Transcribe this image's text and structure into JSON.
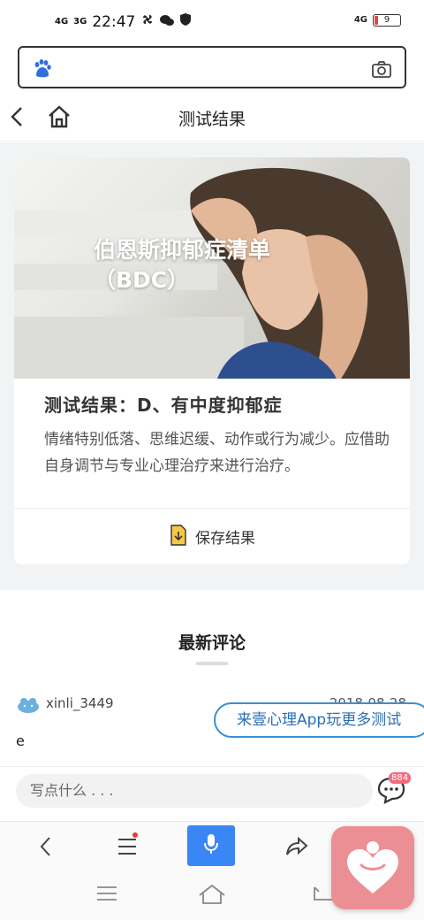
{
  "status_bar": {
    "network_1": "4G",
    "network_2": "3G",
    "time": "22:47",
    "network_right": "4G",
    "battery": "9"
  },
  "search": {
    "value": "",
    "logo_icon": "baidu-paw-icon",
    "camera_icon": "camera-icon"
  },
  "nav": {
    "title": "测试结果",
    "back_icon": "back-arrow-icon",
    "home_icon": "home-icon"
  },
  "card": {
    "hero_title_line1": "伯恩斯抑郁症清单",
    "hero_title_line2": "（BDC）",
    "result_title": "测试结果：D、有中度抑郁症",
    "result_desc": "情绪特别低落、思维迟缓、动作或行为减少。应借助自身调节与专业心理治疗来进行治疗。",
    "save_label": "保存结果"
  },
  "comments": {
    "section_title": "最新评论",
    "items": [
      {
        "user": "xinli_3449",
        "date": "2018-08-28",
        "text": "e"
      }
    ]
  },
  "promo": {
    "label": "来壹心理App玩更多测试"
  },
  "comment_bar": {
    "placeholder": "写点什么 . . .",
    "count": "884"
  },
  "colors": {
    "accent_blue": "#3b86f5",
    "promo_border": "#3a8fd8",
    "badge_pink": "#f36b7f",
    "float_app_bg": "#ec8f95"
  }
}
